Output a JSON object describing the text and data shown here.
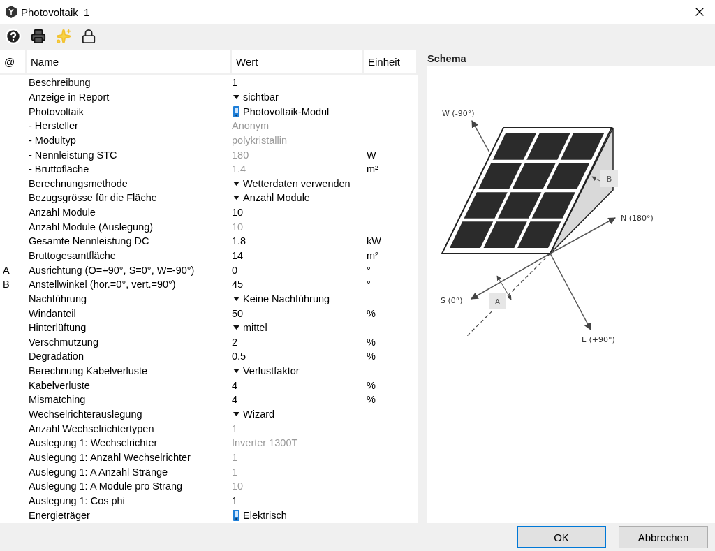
{
  "window": {
    "title": "Photovoltaik  1"
  },
  "toolbar": {
    "items": [
      {
        "kind": "help"
      },
      {
        "kind": "print"
      },
      {
        "kind": "wizard"
      },
      {
        "kind": "lock"
      }
    ]
  },
  "table": {
    "columns": [
      "@",
      "Name",
      "Wert",
      "Einheit"
    ],
    "rows": [
      {
        "ref": "",
        "name": "Beschreibung",
        "value": "1",
        "unit": "",
        "kind": "text",
        "disabled": false
      },
      {
        "ref": "",
        "name": "Anzeige in Report",
        "value": "sichtbar",
        "unit": "",
        "kind": "dropdown",
        "disabled": false
      },
      {
        "ref": "",
        "name": "Photovoltaik",
        "value": "Photovoltaik-Modul",
        "unit": "",
        "kind": "link",
        "disabled": false
      },
      {
        "ref": "",
        "name": "- Hersteller",
        "value": "Anonym",
        "unit": "",
        "kind": "text",
        "disabled": true
      },
      {
        "ref": "",
        "name": "- Modultyp",
        "value": "polykristallin",
        "unit": "",
        "kind": "text",
        "disabled": true
      },
      {
        "ref": "",
        "name": "- Nennleistung STC",
        "value": "180",
        "unit": "W",
        "kind": "text",
        "disabled": true
      },
      {
        "ref": "",
        "name": "- Bruttofläche",
        "value": "1.4",
        "unit": "m²",
        "kind": "text",
        "disabled": true
      },
      {
        "ref": "",
        "name": "Berechnungsmethode",
        "value": "Wetterdaten verwenden",
        "unit": "",
        "kind": "dropdown",
        "disabled": false
      },
      {
        "ref": "",
        "name": "Bezugsgrösse für die Fläche",
        "value": "Anzahl Module",
        "unit": "",
        "kind": "dropdown",
        "disabled": false
      },
      {
        "ref": "",
        "name": "Anzahl Module",
        "value": "10",
        "unit": "",
        "kind": "text",
        "disabled": false
      },
      {
        "ref": "",
        "name": "Anzahl Module (Auslegung)",
        "value": "10",
        "unit": "",
        "kind": "text",
        "disabled": true
      },
      {
        "ref": "",
        "name": "Gesamte Nennleistung DC",
        "value": "1.8",
        "unit": "kW",
        "kind": "text",
        "disabled": false
      },
      {
        "ref": "",
        "name": "Bruttogesamtfläche",
        "value": "14",
        "unit": "m²",
        "kind": "text",
        "disabled": false
      },
      {
        "ref": "A",
        "name": "Ausrichtung (O=+90°, S=0°, W=-90°)",
        "value": "0",
        "unit": "°",
        "kind": "text",
        "disabled": false
      },
      {
        "ref": "B",
        "name": "Anstellwinkel (hor.=0°, vert.=90°)",
        "value": "45",
        "unit": "°",
        "kind": "text",
        "disabled": false
      },
      {
        "ref": "",
        "name": "Nachführung",
        "value": "Keine Nachführung",
        "unit": "",
        "kind": "dropdown",
        "disabled": false
      },
      {
        "ref": "",
        "name": "Windanteil",
        "value": "50",
        "unit": "%",
        "kind": "text",
        "disabled": false
      },
      {
        "ref": "",
        "name": "Hinterlüftung",
        "value": "mittel",
        "unit": "",
        "kind": "dropdown",
        "disabled": false
      },
      {
        "ref": "",
        "name": "Verschmutzung",
        "value": "2",
        "unit": "%",
        "kind": "text",
        "disabled": false
      },
      {
        "ref": "",
        "name": "Degradation",
        "value": "0.5",
        "unit": "%",
        "kind": "text",
        "disabled": false
      },
      {
        "ref": "",
        "name": "Berechnung Kabelverluste",
        "value": "Verlustfaktor",
        "unit": "",
        "kind": "dropdown",
        "disabled": false
      },
      {
        "ref": "",
        "name": "Kabelverluste",
        "value": "4",
        "unit": "%",
        "kind": "text",
        "disabled": false
      },
      {
        "ref": "",
        "name": "Mismatching",
        "value": "4",
        "unit": "%",
        "kind": "text",
        "disabled": false
      },
      {
        "ref": "",
        "name": "Wechselrichterauslegung",
        "value": "Wizard",
        "unit": "",
        "kind": "dropdown",
        "disabled": false
      },
      {
        "ref": "",
        "name": "Anzahl Wechselrichtertypen",
        "value": "1",
        "unit": "",
        "kind": "text",
        "disabled": true
      },
      {
        "ref": "",
        "name": "Auslegung 1: Wechselrichter",
        "value": "Inverter 1300T",
        "unit": "",
        "kind": "text",
        "disabled": true
      },
      {
        "ref": "",
        "name": "Auslegung 1: Anzahl Wechselrichter",
        "value": "1",
        "unit": "",
        "kind": "text",
        "disabled": true
      },
      {
        "ref": "",
        "name": "Auslegung 1: A Anzahl Stränge",
        "value": "1",
        "unit": "",
        "kind": "text",
        "disabled": true
      },
      {
        "ref": "",
        "name": "Auslegung 1: A Module pro Strang",
        "value": "10",
        "unit": "",
        "kind": "text",
        "disabled": true
      },
      {
        "ref": "",
        "name": "Auslegung 1: Cos phi",
        "value": "1",
        "unit": "",
        "kind": "text",
        "disabled": false
      },
      {
        "ref": "",
        "name": "Energieträger",
        "value": "Elektrisch",
        "unit": "",
        "kind": "link",
        "disabled": false
      }
    ]
  },
  "schema": {
    "title": "Schema",
    "labels": {
      "west": "W (-90°)",
      "north": "N (180°)",
      "south": "S (0°)",
      "east": "E (+90°)",
      "tilt": "B",
      "azimuth": "A"
    }
  },
  "buttons": [
    {
      "label": "OK",
      "focused": true
    },
    {
      "label": "Abbrechen",
      "focused": false
    }
  ]
}
